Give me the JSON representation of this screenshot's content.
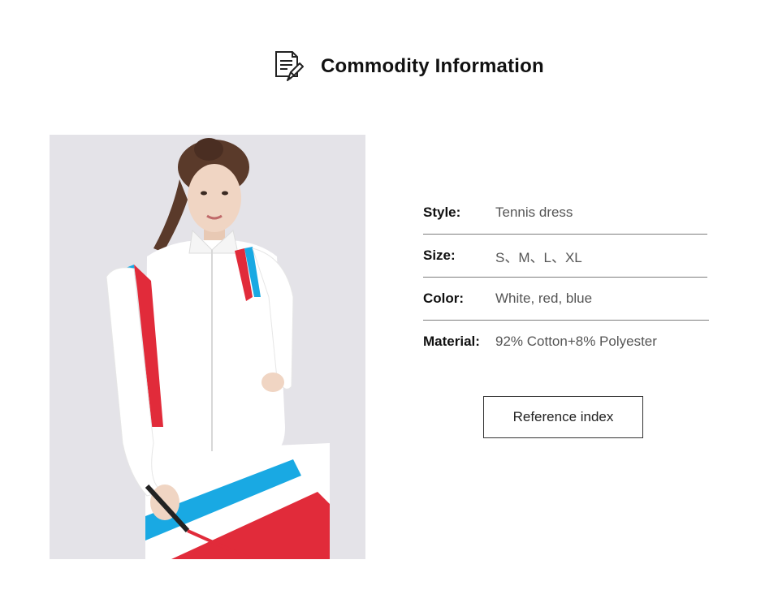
{
  "header": {
    "title": "Commodity Information",
    "icon": "document-edit-icon"
  },
  "product_image": {
    "description_icon": "product-photo"
  },
  "specs": [
    {
      "label": "Style:",
      "value": "Tennis dress"
    },
    {
      "label": "Size:",
      "value": "S、M、L、XL"
    },
    {
      "label": "Color:",
      "value": "White, red, blue"
    },
    {
      "label": "Material:",
      "value": "92% Cotton+8% Polyester"
    }
  ],
  "reference_button": {
    "label": "Reference index"
  },
  "colors": {
    "stripe_blue": "#19a9e3",
    "stripe_red": "#e12b3a",
    "background": "#e4e3e8"
  }
}
